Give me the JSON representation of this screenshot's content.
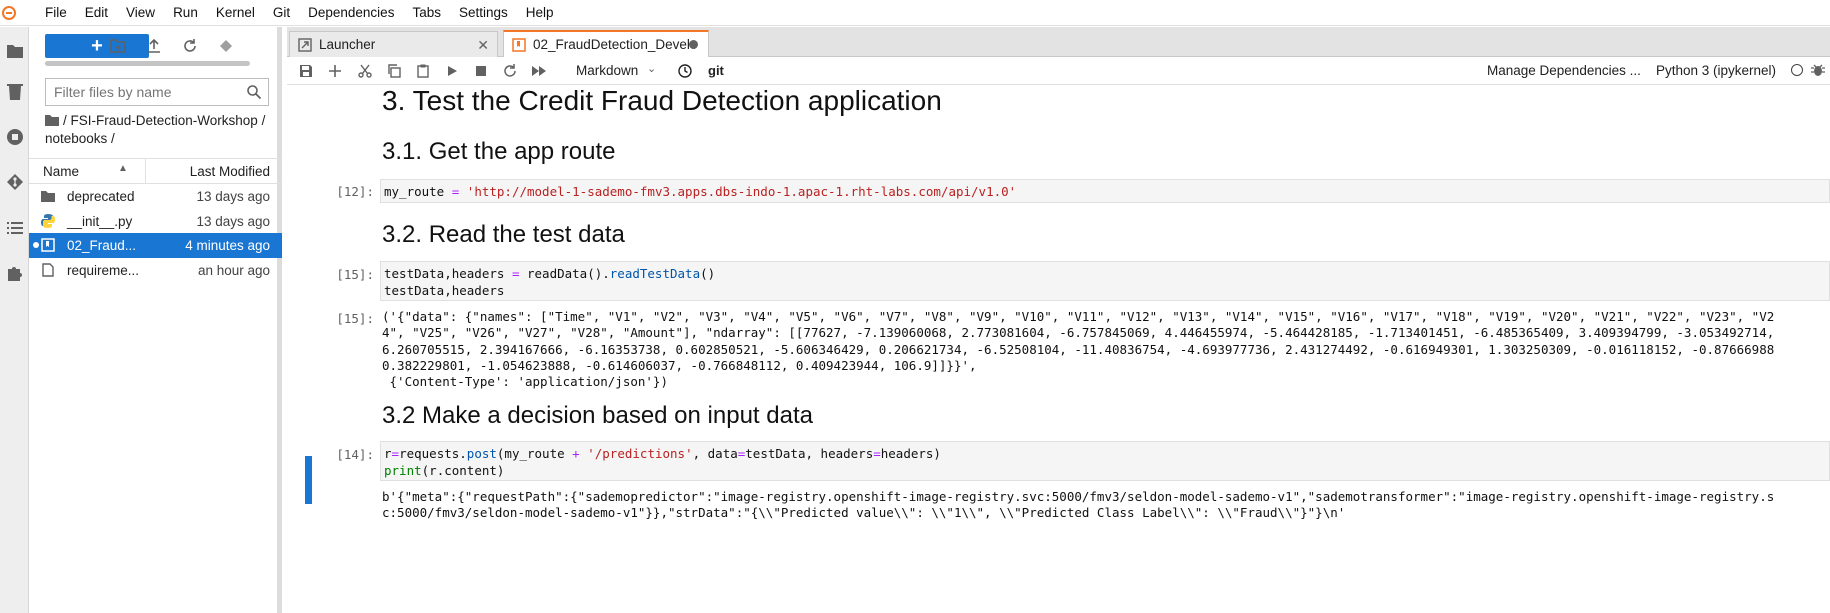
{
  "menubar": {
    "items": [
      "File",
      "Edit",
      "View",
      "Run",
      "Kernel",
      "Git",
      "Dependencies",
      "Tabs",
      "Settings",
      "Help"
    ]
  },
  "sidebar_icons": [
    "folder-icon",
    "trash-icon",
    "stop-circle-icon",
    "git-icon",
    "toc-list-icon",
    "extension-puzzle-icon"
  ],
  "filebrowser": {
    "new_label": "+",
    "search_placeholder": "Filter files by name",
    "breadcrumb": "/ FSI-Fraud-Detection-Workshop / notebooks /",
    "col_name": "Name",
    "col_modified": "Last Modified",
    "files": [
      {
        "name": "deprecated",
        "modified": "13 days ago",
        "icon": "folder-icon",
        "selected": false
      },
      {
        "name": "__init__.py",
        "modified": "13 days ago",
        "icon": "python-icon",
        "selected": false
      },
      {
        "name": "02_Fraud...",
        "modified": "4 minutes ago",
        "icon": "notebook-icon",
        "selected": true
      },
      {
        "name": "requireme...",
        "modified": "an hour ago",
        "icon": "file-icon",
        "selected": false
      }
    ]
  },
  "tabs": [
    {
      "label": "Launcher",
      "active": false
    },
    {
      "label": "02_FraudDetection_Develc",
      "active": true
    }
  ],
  "toolbar": {
    "cell_type": "Markdown",
    "git": "git",
    "manage_dependencies": "Manage Dependencies ...",
    "kernel": "Python 3 (ipykernel)"
  },
  "notebook": {
    "h1": "3. Test the Credit Fraud Detection application",
    "h2_route": "3.1. Get the app route",
    "cell12_prompt": "[12]:",
    "h2_read": "3.2. Read the test data",
    "cell15_prompt": "[15]:",
    "out15_prompt": "[15]:",
    "out15_lines": [
      "('{\"data\": {\"names\": [\"Time\", \"V1\", \"V2\", \"V3\", \"V4\", \"V5\", \"V6\", \"V7\", \"V8\", \"V9\", \"V10\", \"V11\", \"V12\", \"V13\", \"V14\", \"V15\", \"V16\", \"V17\", \"V18\", \"V19\", \"V20\", \"V21\", \"V22\", \"V23\", \"V2",
      "4\", \"V25\", \"V26\", \"V27\", \"V28\", \"Amount\"], \"ndarray\": [[77627, -7.139060068, 2.773081604, -6.757845069, 4.446455974, -5.464428185, -1.713401451, -6.485365409, 3.409394799, -3.053492714,",
      "6.260705515, 2.394167666, -6.16353738, 0.602850521, -5.606346429, 0.206621734, -6.52508104, -11.40836754, -4.693977736, 2.431274492, -0.616949301, 1.303250309, -0.016118152, -0.87666988",
      "0.382229801, -1.054623888, -0.614606037, -0.766848112, 0.409423944, 106.9]]}}',",
      " {'Content-Type': 'application/json'})"
    ],
    "h2_decision": "3.2 Make a decision based on input data",
    "cell14_prompt": "[14]:",
    "out14_lines": [
      "b'{\"meta\":{\"requestPath\":{\"sademopredictor\":\"image-registry.openshift-image-registry.svc:5000/fmv3/seldon-model-sademo-v1\",\"sademotransformer\":\"image-registry.openshift-image-registry.s",
      "c:5000/fmv3/seldon-model-sademo-v1\"}},\"strData\":\"{\\\\\"Predicted value\\\\\": \\\\\"1\\\\\", \\\\\"Predicted Class Label\\\\\": \\\\\"Fraud\\\\\"}\"}\\n'"
    ]
  }
}
